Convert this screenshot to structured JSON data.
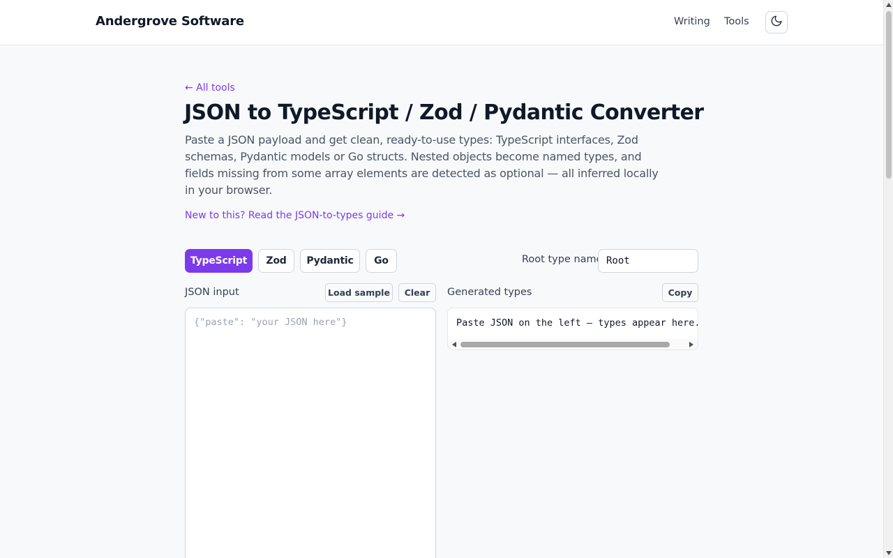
{
  "header": {
    "brand": "Andergrove Software",
    "nav": [
      "Writing",
      "Tools"
    ],
    "theme_toggle_icon": "moon-icon"
  },
  "page": {
    "back_link": "← All tools",
    "title": "JSON to TypeScript / Zod / Pydantic Converter",
    "intro": "Paste a JSON payload and get clean, ready-to-use types: TypeScript interfaces, Zod schemas, Pydantic models or Go structs. Nested objects become named types, and fields missing from some array elements are detected as optional — all inferred locally in your browser.",
    "guide_link": "New to this? Read the JSON-to-types guide →"
  },
  "tabs": {
    "items": [
      "TypeScript",
      "Zod",
      "Pydantic",
      "Go"
    ],
    "active": "TypeScript"
  },
  "root_type": {
    "label": "Root type name",
    "value": "Root"
  },
  "input_panel": {
    "label": "JSON input",
    "load_sample": "Load sample",
    "clear": "Clear",
    "value": "",
    "placeholder": "{\"paste\": \"your JSON here\"}"
  },
  "output_panel": {
    "label": "Generated types",
    "copy": "Copy",
    "text": "Paste JSON on the left — types appear here."
  },
  "colors": {
    "accent": "#7c3aed",
    "page_bg": "#f8f9fb",
    "text": "#111827"
  }
}
